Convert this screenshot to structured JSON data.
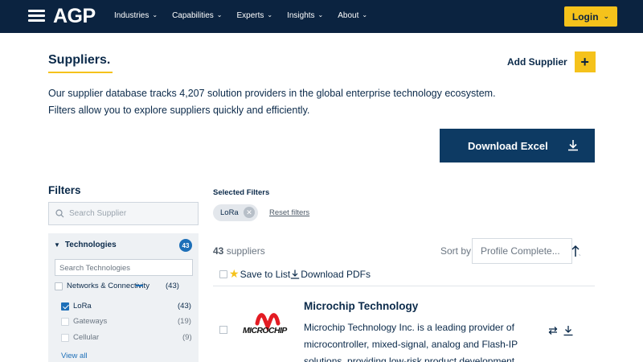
{
  "nav": {
    "logo": "AGP",
    "items": [
      {
        "label": "Industries"
      },
      {
        "label": "Capabilities"
      },
      {
        "label": "Experts"
      },
      {
        "label": "Insights"
      },
      {
        "label": "About"
      }
    ],
    "login_label": "Login"
  },
  "header": {
    "title": "Suppliers.",
    "add_supplier_label": "Add Supplier",
    "intro_line1": "Our supplier database tracks 4,207 solution providers in the global enterprise technology ecosystem.",
    "intro_line2": "Filters allow you to explore suppliers quickly and efficiently.",
    "download_excel_label": "Download Excel"
  },
  "filters": {
    "title": "Filters",
    "search_placeholder": "Search Supplier",
    "technologies": {
      "label": "Technologies",
      "count": "43",
      "search_placeholder": "Search Technologies",
      "category": {
        "label": "Networks & Connectivity",
        "count": "(43)"
      },
      "items": [
        {
          "label": "LoRa",
          "count": "(43)",
          "checked": true
        },
        {
          "label": "Gateways",
          "count": "(19)",
          "checked": false
        },
        {
          "label": "Cellular",
          "count": "(9)",
          "checked": false
        }
      ],
      "view_all_label": "View all"
    }
  },
  "results": {
    "selected_filters_title": "Selected Filters",
    "chips": [
      {
        "label": "LoRa"
      }
    ],
    "reset_label": "Reset filters",
    "count_number": "43",
    "count_suffix": "suppliers",
    "sort_by_label": "Sort by:",
    "sort_value": "Profile Complete...",
    "save_to_list_label": "Save to List",
    "download_pdfs_label": "Download PDFs",
    "items": [
      {
        "logo_text": "MICROCHIP",
        "name": "Microchip Technology",
        "description": "Microchip Technology Inc. is a leading provider of microcontroller, mixed-signal, analog and Flash-IP solutions, providing low-risk product development,"
      }
    ]
  },
  "colors": {
    "navy": "#0b2340",
    "accent_yellow": "#f5c21b",
    "link_blue": "#1d6fb8",
    "button_blue": "#0d3a63"
  }
}
